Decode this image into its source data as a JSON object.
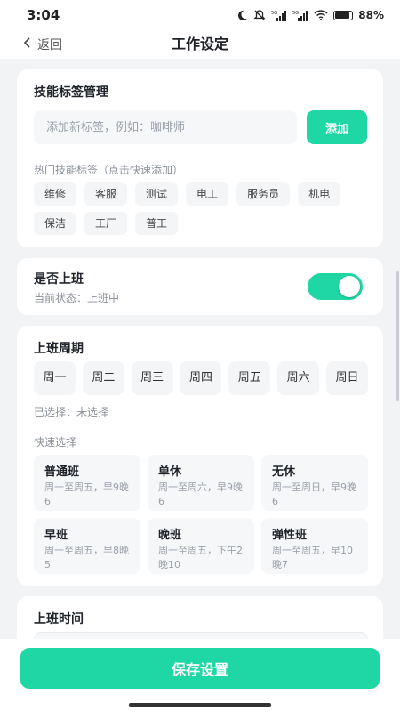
{
  "status": {
    "time": "3:04",
    "network": "5G",
    "battery": "88%",
    "icons": [
      "moon-icon",
      "mute-icon",
      "signal-icon",
      "signal-icon",
      "wifi-icon",
      "battery-icon"
    ]
  },
  "header": {
    "back": "返回",
    "title": "工作设定"
  },
  "skills": {
    "title": "技能标签管理",
    "placeholder": "添加新标签，例如：咖啡师",
    "add": "添加",
    "hot_title": "热门技能标签（点击快速添加）",
    "tags": [
      "维修",
      "客服",
      "测试",
      "电工",
      "服务员",
      "机电",
      "保洁",
      "工厂",
      "普工"
    ]
  },
  "work_switch": {
    "title": "是否上班",
    "status": "当前状态：上班中",
    "on": true
  },
  "schedule": {
    "title": "上班周期",
    "days": [
      "周一",
      "周二",
      "周三",
      "周四",
      "周五",
      "周六",
      "周日"
    ],
    "selected": "已选择：未选择",
    "quick_title": "快速选择",
    "presets": [
      {
        "name": "普通班",
        "desc": "周一至周五，早9晚6"
      },
      {
        "name": "单休",
        "desc": "周一至周六，早9晚6"
      },
      {
        "name": "无休",
        "desc": "周一至周日，早9晚6"
      },
      {
        "name": "早班",
        "desc": "周一至周五，早8晚5"
      },
      {
        "name": "晚班",
        "desc": "周一至周五，下午2晚10"
      },
      {
        "name": "弹性班",
        "desc": "周一至周五，早10晚7"
      }
    ]
  },
  "work_time": {
    "title": "上班时间"
  },
  "save": "保存设置",
  "colors": {
    "accent": "#1fd6a5",
    "background": "#f2f3f5"
  }
}
